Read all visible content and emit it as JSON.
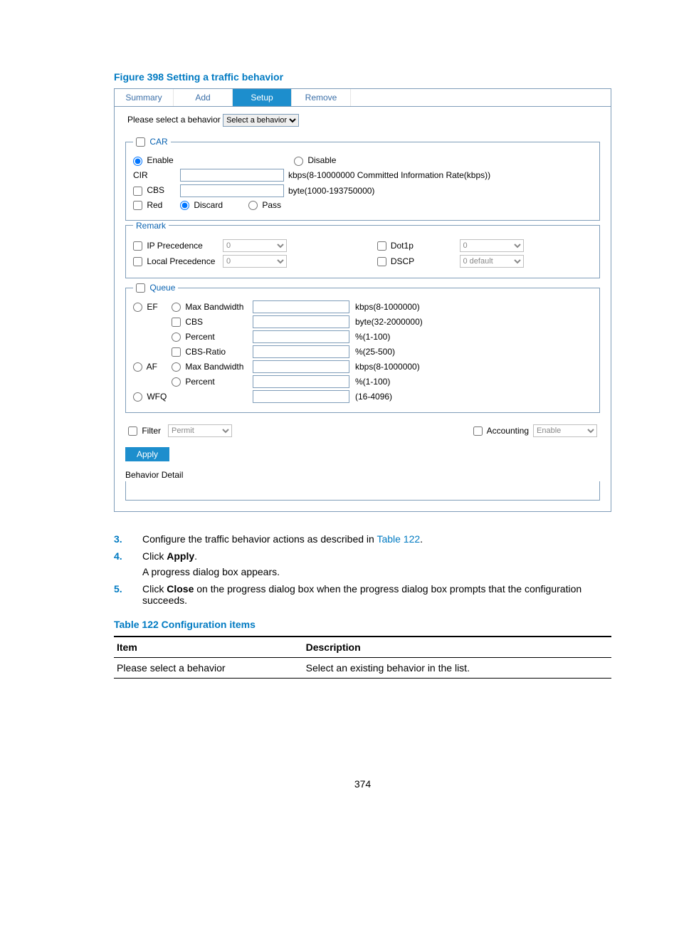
{
  "figure_title": "Figure 398 Setting a traffic behavior",
  "tabs": {
    "summary": "Summary",
    "add": "Add",
    "setup": "Setup",
    "remove": "Remove"
  },
  "select_row": {
    "label": "Please select a behavior",
    "option": "Select a behavior"
  },
  "car": {
    "legend": "CAR",
    "enable": "Enable",
    "disable": "Disable",
    "cir_label": "CIR",
    "cir_hint": "kbps(8-10000000 Committed Information Rate(kbps))",
    "cbs_label": "CBS",
    "cbs_hint": "byte(1000-193750000)",
    "red_label": "Red",
    "discard": "Discard",
    "pass": "Pass"
  },
  "remark": {
    "legend": "Remark",
    "ip_precedence": "IP Precedence",
    "local_precedence": "Local Precedence",
    "dot1p": "Dot1p",
    "dscp": "DSCP",
    "val0": "0",
    "val0default": "0 default"
  },
  "queue": {
    "legend": "Queue",
    "ef": "EF",
    "af": "AF",
    "wfq": "WFQ",
    "maxbw": "Max Bandwidth",
    "cbs": "CBS",
    "percent": "Percent",
    "cbs_ratio": "CBS-Ratio",
    "h_kbps": "kbps(8-1000000)",
    "h_byte": "byte(32-2000000)",
    "h_pct": "%(1-100)",
    "h_ratio": "%(25-500)",
    "h_wfq": "(16-4096)"
  },
  "bottom": {
    "filter": "Filter",
    "permit": "Permit",
    "accounting": "Accounting",
    "enable": "Enable",
    "apply": "Apply",
    "behavior_detail": "Behavior Detail"
  },
  "steps": {
    "s3a": "Configure the traffic behavior actions as described in ",
    "s3link": "Table 122",
    "s3b": ".",
    "s4a": "Click ",
    "s4b": "Apply",
    "s4c": ".",
    "s4note": "A progress dialog box appears.",
    "s5a": "Click ",
    "s5b": "Close",
    "s5c": " on the progress dialog box when the progress dialog box prompts that the configuration succeeds."
  },
  "table": {
    "title": "Table 122 Configuration items",
    "h_item": "Item",
    "h_desc": "Description",
    "r1_item": "Please select a behavior",
    "r1_desc": "Select an existing behavior in the list."
  },
  "page_number": "374"
}
